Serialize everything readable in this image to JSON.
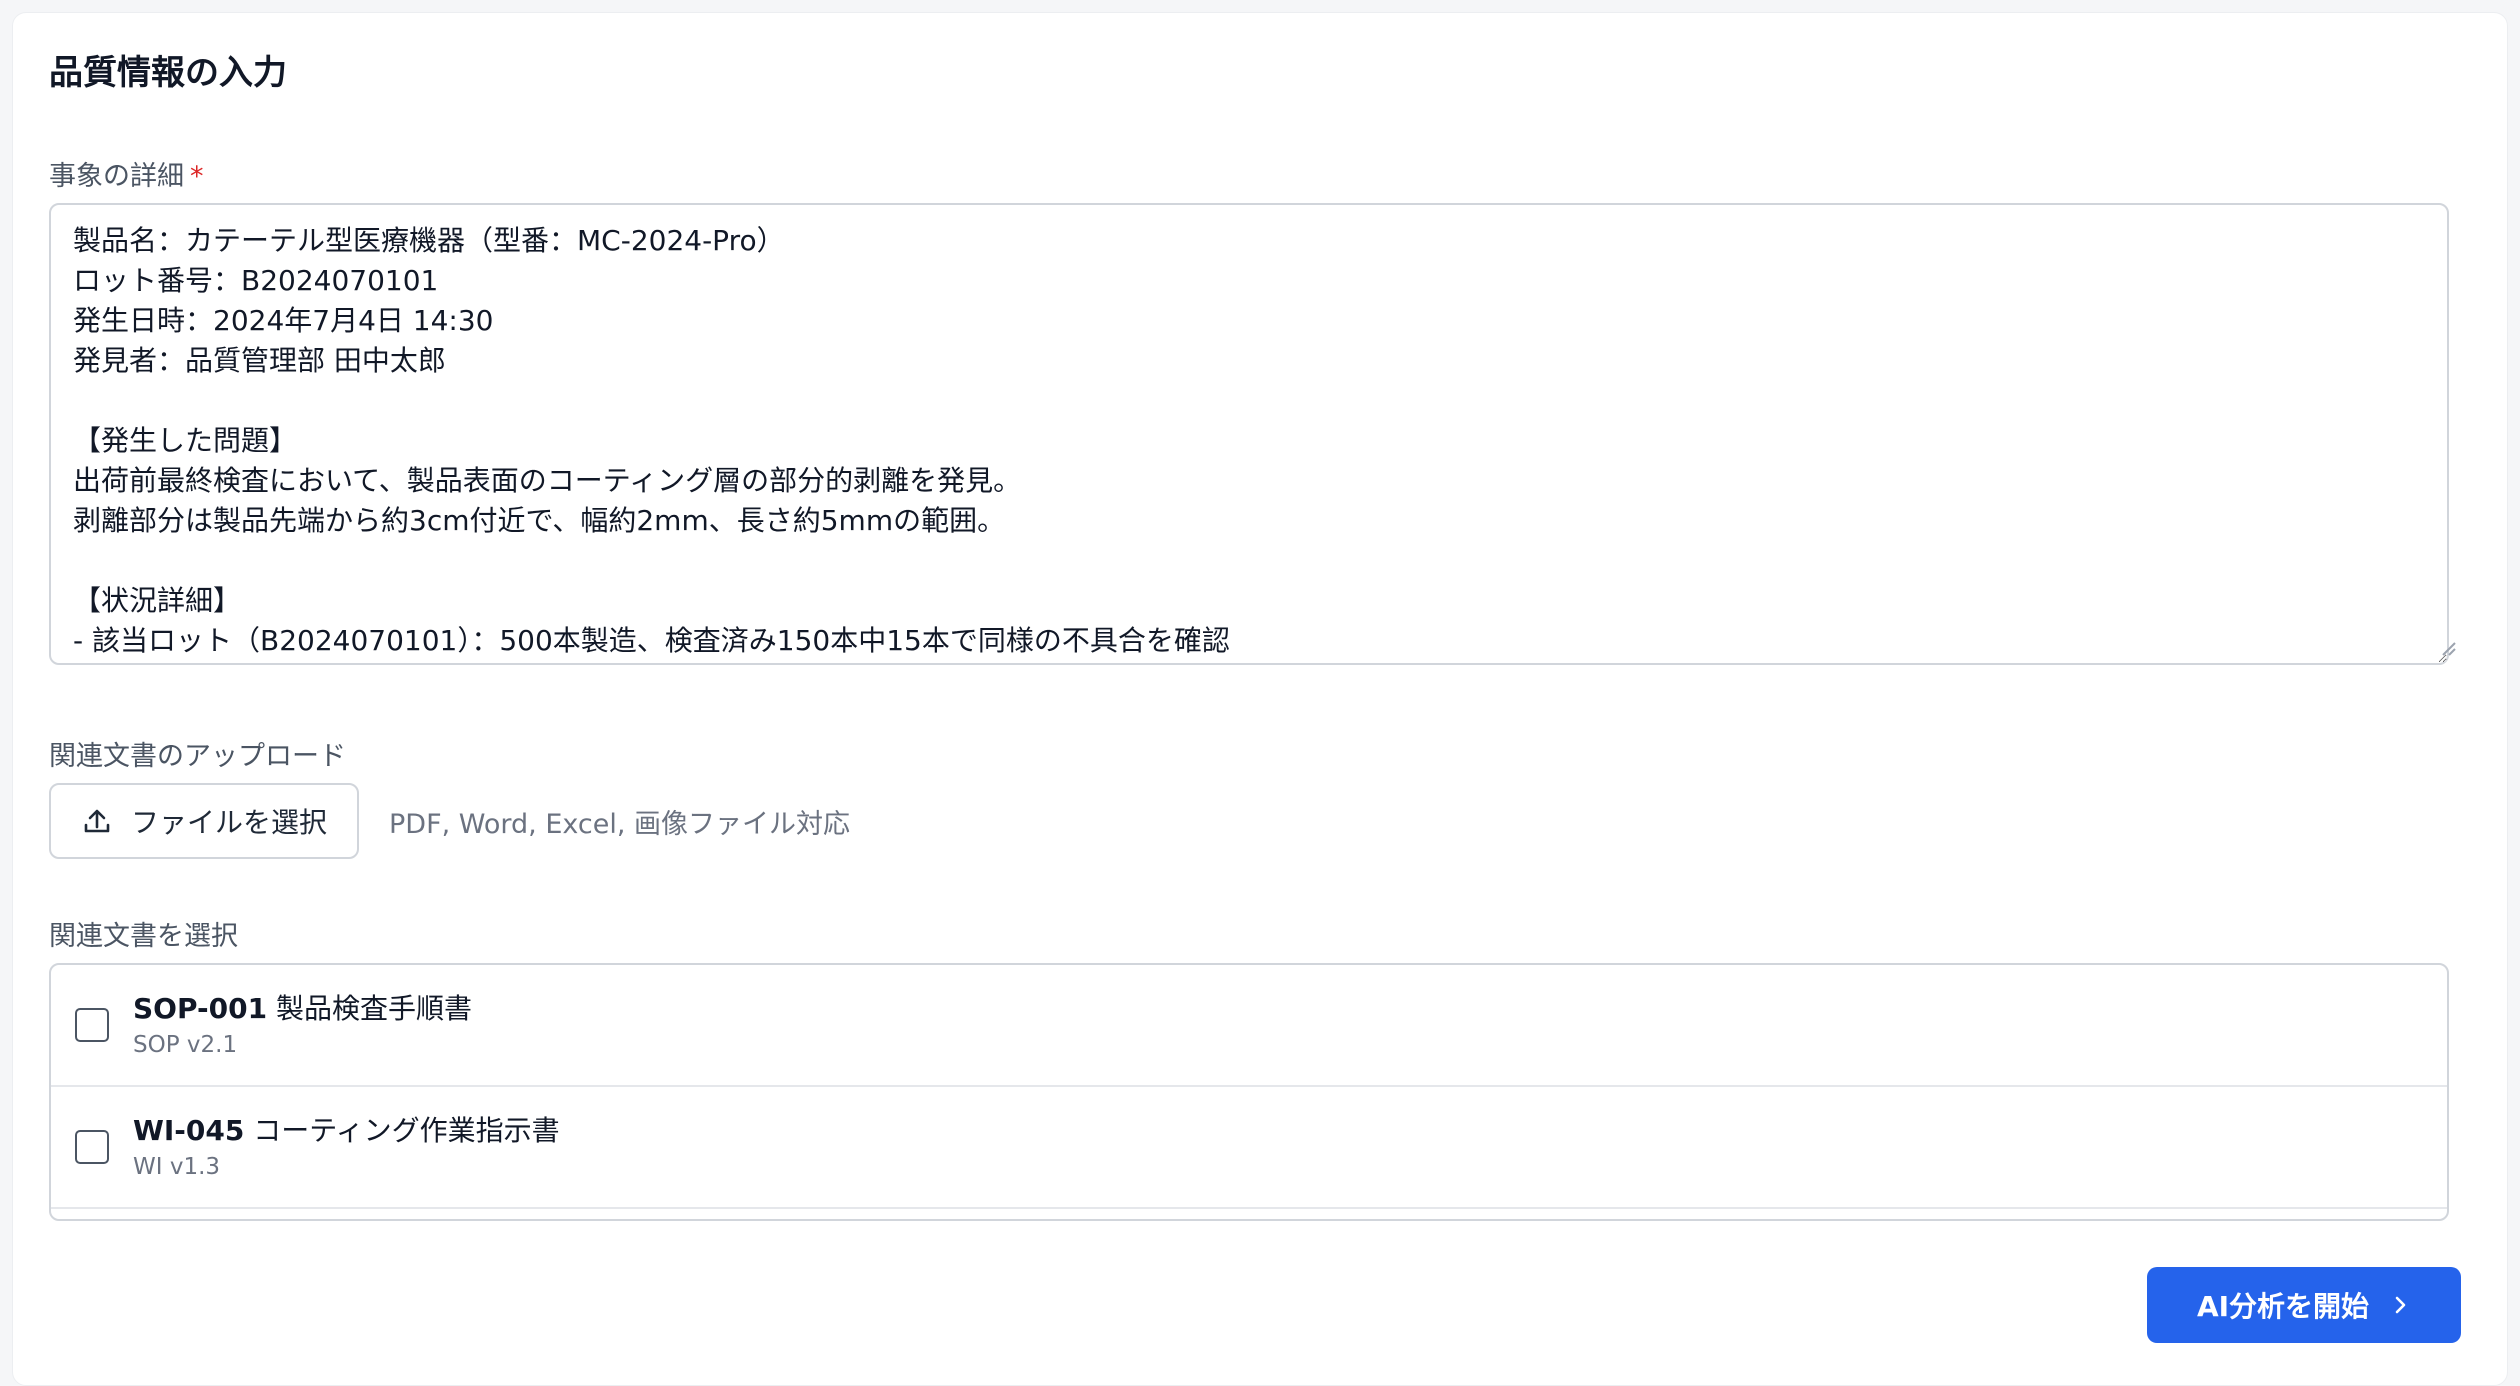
{
  "form": {
    "heading": "品質情報の入力",
    "details_label": "事象の詳細",
    "required_mark": "*",
    "details_value": "製品名：カテーテル型医療機器（型番：MC-2024-Pro）\nロット番号：B2024070101\n発生日時：2024年7月4日 14:30\n発見者：品質管理部 田中太郎\n\n【発生した問題】\n出荷前最終検査において、製品表面のコーティング層の部分的剥離を発見。\n剥離部分は製品先端から約3cm付近で、幅約2mm、長さ約5mmの範囲。\n\n【状況詳細】\n- 該当ロット（B2024070101）：500本製造、検査済み150本中15本で同様の不具合を確認"
  },
  "upload": {
    "label": "関連文書のアップロード",
    "button_label": "ファイルを選択",
    "button_icon": "upload-icon",
    "hint": "PDF, Word, Excel, 画像ファイル対応"
  },
  "documents": {
    "label": "関連文書を選択",
    "items": [
      {
        "code": "SOP-001",
        "title": "製品検査手順書",
        "version": "SOP v2.1",
        "checked": false
      },
      {
        "code": "WI-045",
        "title": "コーティング作業指示書",
        "version": "WI v1.3",
        "checked": false
      }
    ]
  },
  "actions": {
    "analyze_label": "AI分析を開始",
    "analyze_icon": "chevron-right-icon",
    "accent_color": "#2563eb"
  }
}
